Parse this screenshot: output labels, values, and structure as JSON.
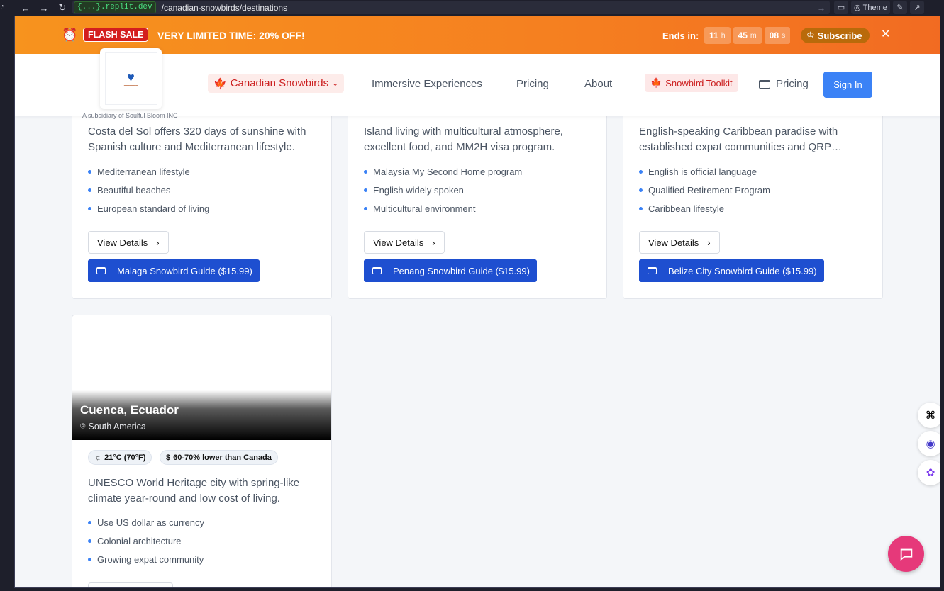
{
  "browser": {
    "url_host": "{...}.replit.dev",
    "url_path": "/canadian-snowbirds/destinations",
    "theme_label": "Theme"
  },
  "flash_sale": {
    "badge": "FLASH SALE",
    "message": "VERY LIMITED TIME:  20% OFF!",
    "ends_label": "Ends in:",
    "hours": "11",
    "hours_unit": "h",
    "minutes": "45",
    "minutes_unit": "m",
    "seconds": "08",
    "seconds_unit": "s",
    "subscribe_label": "Subscribe"
  },
  "header": {
    "subsidiary": "A subsidiary of Soulful Bloom INC",
    "nav": {
      "canadian_snowbirds": "Canadian Snowbirds",
      "immersive": "Immersive Experiences",
      "pricing": "Pricing",
      "about": "About",
      "toolkit": "Snowbird Toolkit",
      "pricing2": "Pricing",
      "sign_in": "Sign In"
    }
  },
  "cards": [
    {
      "description": "Costa del Sol offers 320 days of sunshine with Spanish culture and Mediterranean lifestyle.",
      "features": [
        "Mediterranean lifestyle",
        "Beautiful beaches",
        "European standard of living"
      ],
      "view_details": "View Details",
      "guide_button": "Malaga Snowbird Guide ($15.99)"
    },
    {
      "description": "Island living with multicultural atmosphere, excellent food, and MM2H visa program.",
      "features": [
        "Malaysia My Second Home program",
        "English widely spoken",
        "Multicultural environment"
      ],
      "view_details": "View Details",
      "guide_button": "Penang Snowbird Guide ($15.99)"
    },
    {
      "description": "English-speaking Caribbean paradise with established expat communities and QRP…",
      "features": [
        "English is official language",
        "Qualified Retirement Program",
        "Caribbean lifestyle"
      ],
      "view_details": "View Details",
      "guide_button": "Belize City Snowbird Guide ($15.99)"
    },
    {
      "title": "Cuenca, Ecuador",
      "region": "South America",
      "temp_chip": "21°C (70°F)",
      "cost_chip": "60-70% lower than Canada",
      "description": "UNESCO World Heritage city with spring-like climate year-round and low cost of living.",
      "features": [
        "Use US dollar as currency",
        "Colonial architecture",
        "Growing expat community"
      ]
    }
  ],
  "colors": {
    "accent_blue": "#3b82f6",
    "guide_blue": "#1e4fd0",
    "flash_orange": "#f57f20",
    "sale_red": "#d41e1e",
    "chat_pink": "#e6397a"
  }
}
